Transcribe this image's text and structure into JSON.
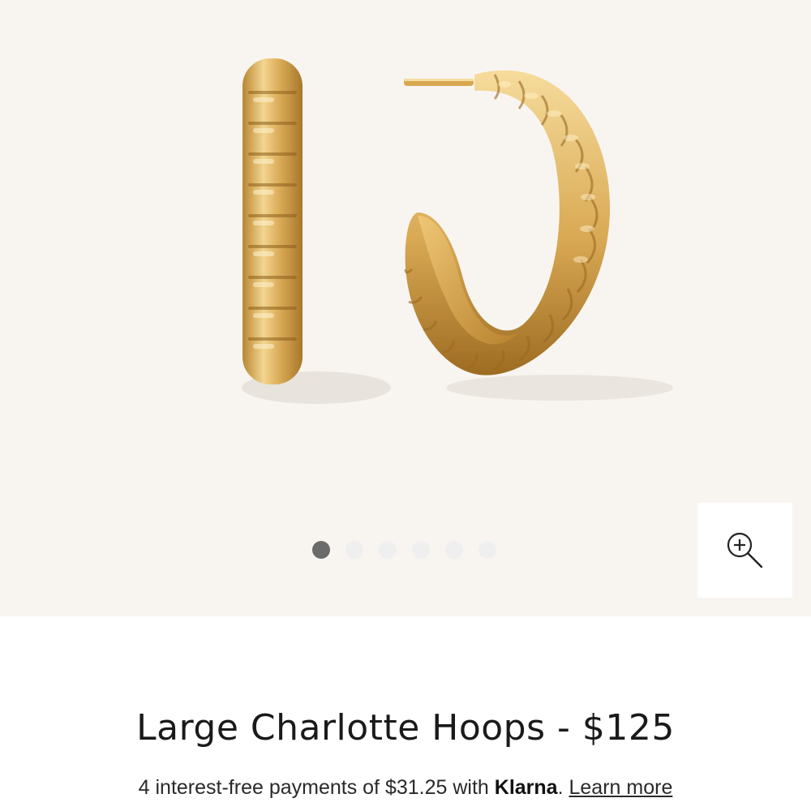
{
  "product": {
    "title": "Large Charlotte Hoops - $125",
    "image_alt": "Large Charlotte Hoops gold ridged hoop earrings"
  },
  "gallery": {
    "slide_count": 6,
    "active_slide": 1,
    "zoom_icon": "zoom-in-icon",
    "background_color": "#f8f5f1"
  },
  "payment": {
    "prefix": "4 interest-free payments of $31.25 with",
    "provider": "Klarna",
    "separator": ".",
    "learn_more": "Learn more"
  },
  "colors": {
    "gold": "#d9ab57",
    "gold_dark": "#b07e2a",
    "gold_light": "#f5d893",
    "dot_active": "#6b6b6b",
    "dot_inactive": "#efefef"
  }
}
